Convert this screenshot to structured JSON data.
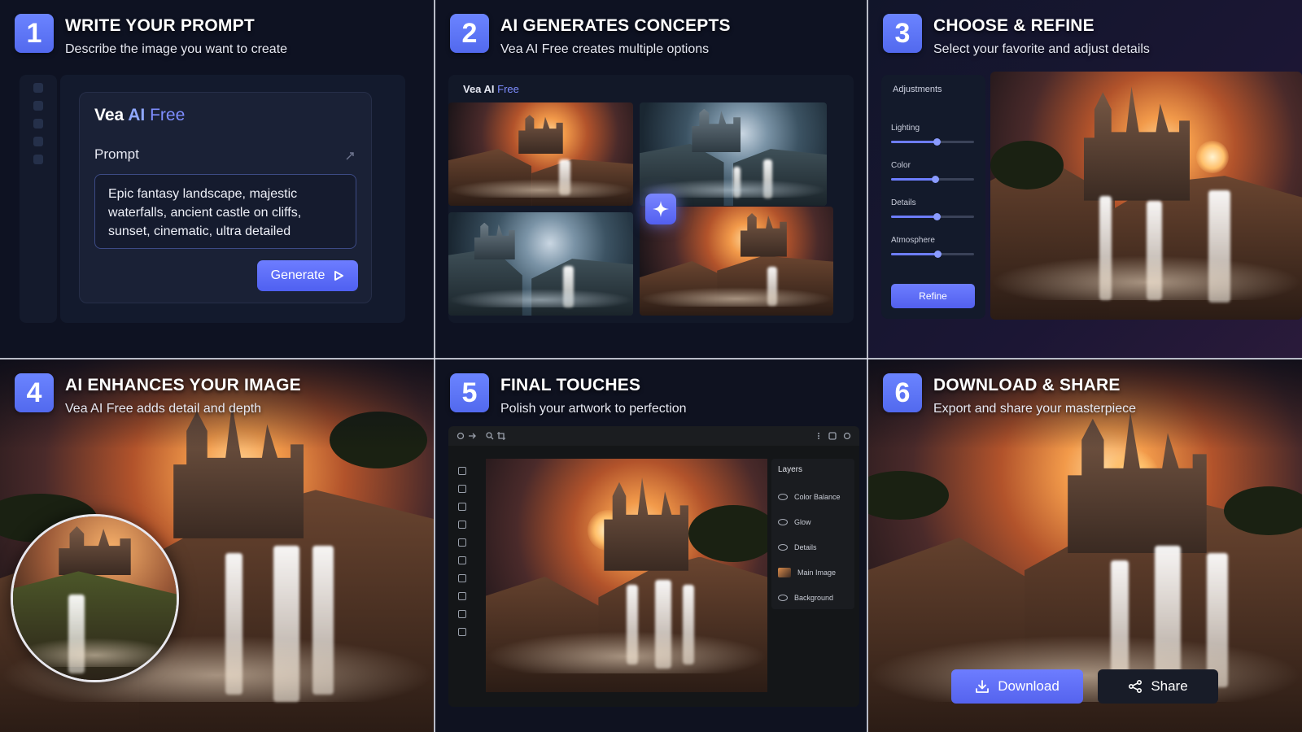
{
  "steps": [
    {
      "number": "1",
      "title": "WRITE YOUR PROMPT",
      "subtitle": "Describe the image you want to create"
    },
    {
      "number": "2",
      "title": "AI GENERATES CONCEPTS",
      "subtitle": "Vea AI Free creates multiple options"
    },
    {
      "number": "3",
      "title": "CHOOSE & REFINE",
      "subtitle": "Select your favorite and adjust details"
    },
    {
      "number": "4",
      "title": "AI ENHANCES YOUR IMAGE",
      "subtitle": "Vea AI Free adds detail and depth"
    },
    {
      "number": "5",
      "title": "FINAL TOUCHES",
      "subtitle": "Polish your artwork to perfection"
    },
    {
      "number": "6",
      "title": "DOWNLOAD & SHARE",
      "subtitle": "Export and share your masterpiece"
    }
  ],
  "prompt_card": {
    "brand_vea": "Vea ",
    "brand_ai": "AI",
    "brand_free": " Free",
    "prompt_label": "Prompt",
    "prompt_text": "Epic fantasy landscape, majestic waterfalls, ancient castle on cliffs, sunset, cinematic, ultra detailed",
    "generate_label": "Generate",
    "generate_icon": "play-icon"
  },
  "gallery": {
    "brand": "Vea AI",
    "brand_free": " Free",
    "spark_icon": "sparkle-icon"
  },
  "adjustments": {
    "title": "Adjustments",
    "sliders": [
      {
        "label": "Lighting",
        "value": 0.55
      },
      {
        "label": "Color",
        "value": 0.53
      },
      {
        "label": "Details",
        "value": 0.55
      },
      {
        "label": "Atmosphere",
        "value": 0.56
      }
    ],
    "refine_label": "Refine"
  },
  "layers": {
    "title": "Layers",
    "items": [
      {
        "label": "Color Balance"
      },
      {
        "label": "Glow"
      },
      {
        "label": "Details"
      },
      {
        "label": "Main Image"
      },
      {
        "label": "Background"
      }
    ]
  },
  "export": {
    "download_label": "Download",
    "share_label": "Share"
  },
  "colors": {
    "accent": "#5b6cf5",
    "background": "#0e1222"
  }
}
